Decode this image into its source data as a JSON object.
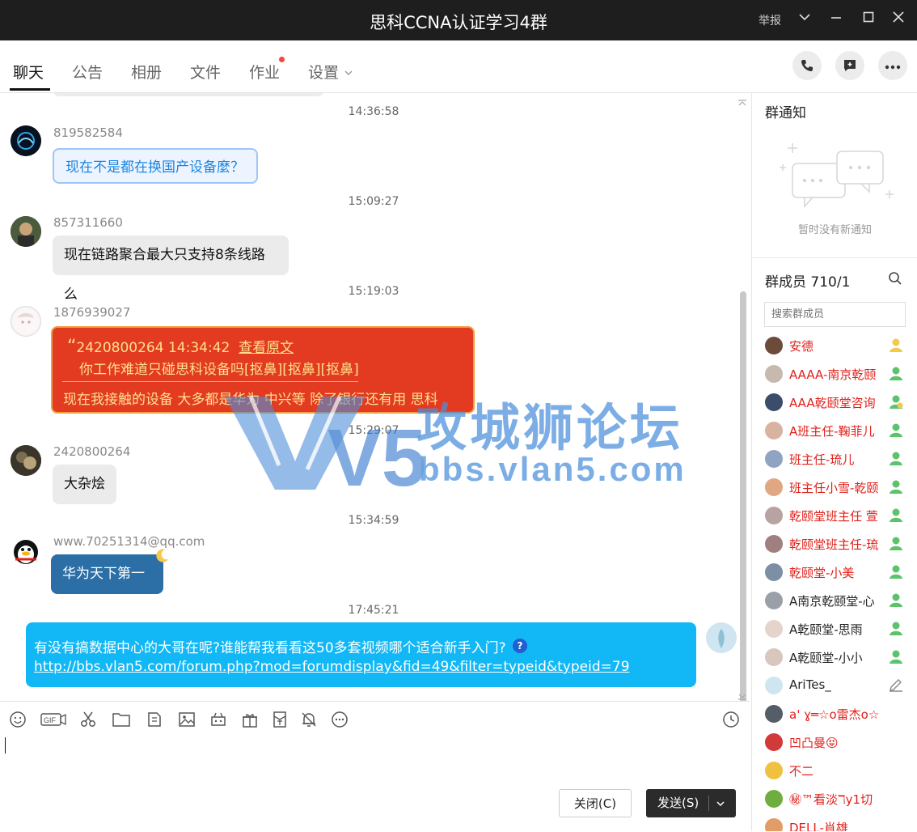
{
  "window": {
    "title": "思科CCNA认证学习4群",
    "report": "举报"
  },
  "tabs": [
    {
      "label": "聊天"
    },
    {
      "label": "公告"
    },
    {
      "label": "相册"
    },
    {
      "label": "文件"
    },
    {
      "label": "作业"
    },
    {
      "label": "设置"
    }
  ],
  "messages": [
    {
      "time": "14:36:58",
      "sender": "819582584",
      "text": "现在不是都在换国产设备麼？"
    },
    {
      "time": "15:09:27",
      "sender": "857311660",
      "text": "现在链路聚合最大只支持8条线路么"
    },
    {
      "time": "15:19:03",
      "sender": "1876939027",
      "quote_head": "2420800264   14:34:42",
      "quote_link": "查看原文",
      "quote_body": "你工作难道只碰思科设备吗[抠鼻][抠鼻][抠鼻]",
      "text": "现在我接触的设备  大多都是华为  中兴等  除了银行还有用  思科"
    },
    {
      "time": "15:29:07",
      "sender": "2420800264",
      "text": "大杂烩"
    },
    {
      "time": "15:34:59",
      "sender": "www.70251314@qq.com",
      "text": "华为天下第一"
    },
    {
      "time": "17:45:21",
      "text": "有没有搞数据中心的大哥在呢?谁能帮我看看这50多套视频哪个适合新手入门?",
      "link": "http://bbs.vlan5.com/forum.php?mod=forumdisplay&fid=49&filter=typeid&typeid=79"
    }
  ],
  "watermark": {
    "brand": "攻城狮论坛",
    "url": "bbs.vlan5.com",
    "logo": "V5"
  },
  "buttons": {
    "close": "关闭(C)",
    "send": "发送(S)"
  },
  "notice": {
    "title": "群通知",
    "empty": "暂时没有新通知"
  },
  "members": {
    "title": "群成员 710/1",
    "search_placeholder": "搜索群成员",
    "list": [
      {
        "name": "安德",
        "color": "#e0201a"
      },
      {
        "name": "AAAA-南京乾颐",
        "color": "#e0201a"
      },
      {
        "name": "AAA乾颐堂咨询",
        "color": "#e0201a"
      },
      {
        "name": "A班主任-鞠菲儿",
        "color": "#e0201a"
      },
      {
        "name": "班主任-琉儿",
        "color": "#e0201a"
      },
      {
        "name": "班主任小雪-乾颐",
        "color": "#e0201a"
      },
      {
        "name": "乾颐堂班主任 萱",
        "color": "#e0201a"
      },
      {
        "name": "乾颐堂班主任-琉",
        "color": "#e0201a"
      },
      {
        "name": "乾颐堂-小美",
        "color": "#e0201a"
      },
      {
        "name": "A南京乾颐堂-心",
        "color": "#222222"
      },
      {
        "name": "A乾颐堂-思雨",
        "color": "#222222"
      },
      {
        "name": "A乾颐堂-小小",
        "color": "#222222"
      },
      {
        "name": "AriTes_",
        "color": "#222222"
      },
      {
        "name": "a' ɣ═☆o雷杰o☆",
        "color": "#e0201a"
      },
      {
        "name": "凹凸曼😝",
        "color": "#e0201a"
      },
      {
        "name": "不二",
        "color": "#e0201a"
      },
      {
        "name": "㊙™看淡ℸy1切",
        "color": "#e0201a"
      },
      {
        "name": "DELL-肖雄",
        "color": "#e0201a"
      }
    ]
  }
}
